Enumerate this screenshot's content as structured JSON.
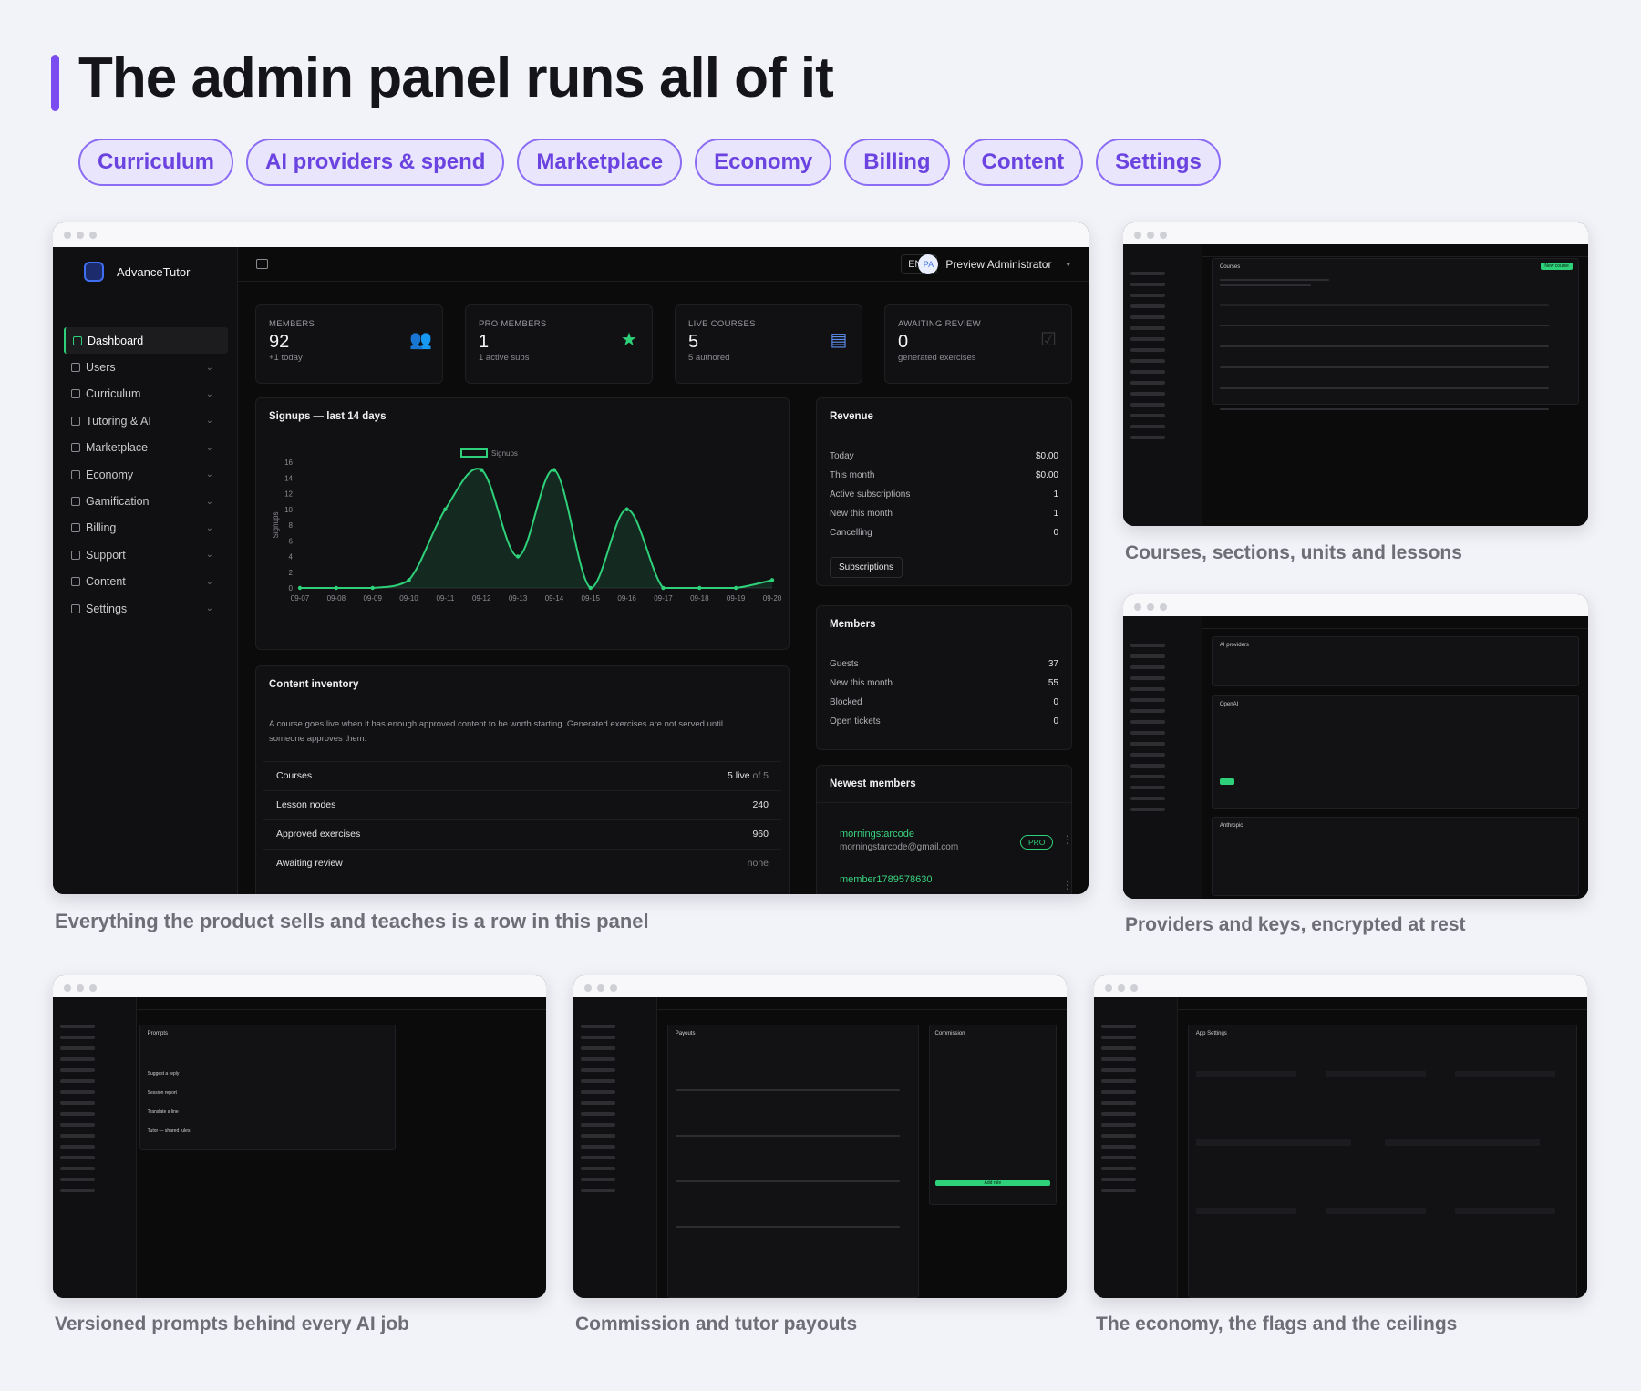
{
  "heading": "The admin panel runs all of it",
  "tags": [
    "Curriculum",
    "AI providers & spend",
    "Marketplace",
    "Economy",
    "Billing",
    "Content",
    "Settings"
  ],
  "captions": {
    "main": "Everything the product sells and teaches is a row in this panel",
    "courses": "Courses, sections, units and lessons",
    "providers": "Providers and keys, encrypted at rest",
    "prompts": "Versioned prompts behind every AI job",
    "payouts": "Commission and tutor payouts",
    "economy": "The economy, the flags and the ceilings"
  },
  "app": {
    "brand": "AdvanceTutor",
    "lang": "EN",
    "user_initials": "PA",
    "user_name": "Preview Administrator",
    "nav": [
      {
        "label": "Dashboard",
        "icon": "grid-icon",
        "active": true
      },
      {
        "label": "Users",
        "icon": "user-icon"
      },
      {
        "label": "Curriculum",
        "icon": "book-icon"
      },
      {
        "label": "Tutoring & AI",
        "icon": "robot-icon"
      },
      {
        "label": "Marketplace",
        "icon": "store-icon"
      },
      {
        "label": "Economy",
        "icon": "gem-icon"
      },
      {
        "label": "Gamification",
        "icon": "trophy-icon"
      },
      {
        "label": "Billing",
        "icon": "card-icon"
      },
      {
        "label": "Support",
        "icon": "chat-icon"
      },
      {
        "label": "Content",
        "icon": "file-icon"
      },
      {
        "label": "Settings",
        "icon": "gear-icon"
      }
    ],
    "stats": [
      {
        "label": "MEMBERS",
        "value": "92",
        "sub": "+1 today",
        "icon": "users-icon"
      },
      {
        "label": "PRO MEMBERS",
        "value": "1",
        "sub": "1 active subs",
        "icon": "star-icon"
      },
      {
        "label": "LIVE COURSES",
        "value": "5",
        "sub": "5 authored",
        "icon": "book-open-icon"
      },
      {
        "label": "AWAITING REVIEW",
        "value": "0",
        "sub": "generated exercises",
        "icon": "check-icon"
      }
    ],
    "signups": {
      "title": "Signups — last 14 days"
    },
    "revenue": {
      "title": "Revenue",
      "rows": [
        {
          "label": "Today",
          "value": "$0.00"
        },
        {
          "label": "This month",
          "value": "$0.00"
        },
        {
          "label": "Active subscriptions",
          "value": "1"
        },
        {
          "label": "New this month",
          "value": "1"
        },
        {
          "label": "Cancelling",
          "value": "0"
        }
      ],
      "button": "Subscriptions"
    },
    "members": {
      "title": "Members",
      "rows": [
        {
          "label": "Guests",
          "value": "37"
        },
        {
          "label": "New this month",
          "value": "55"
        },
        {
          "label": "Blocked",
          "value": "0"
        },
        {
          "label": "Open tickets",
          "value": "0"
        }
      ]
    },
    "newest": {
      "title": "Newest members",
      "items": [
        {
          "name": "morningstarcode",
          "email": "morningstarcode@gmail.com",
          "badge": "PRO"
        },
        {
          "name": "member1789578630",
          "email": ""
        }
      ]
    },
    "inventory": {
      "title": "Content inventory",
      "desc": "A course goes live when it has enough approved content to be worth starting. Generated exercises are not served until someone approves them.",
      "rows": [
        {
          "label": "Courses",
          "value": "5 live",
          "suffix": "of 5"
        },
        {
          "label": "Lesson nodes",
          "value": "240",
          "suffix": ""
        },
        {
          "label": "Approved exercises",
          "value": "960",
          "suffix": ""
        },
        {
          "label": "Awaiting review",
          "value": "none",
          "suffix": ""
        }
      ]
    }
  },
  "chart_data": {
    "type": "line",
    "title": "Signups — last 14 days",
    "ylabel": "Signups",
    "x": [
      "09-07",
      "09-08",
      "09-09",
      "09-10",
      "09-11",
      "09-12",
      "09-13",
      "09-14",
      "09-15",
      "09-16",
      "09-17",
      "09-18",
      "09-19",
      "09-20"
    ],
    "series": [
      {
        "name": "Signups",
        "values": [
          0,
          0,
          0,
          1,
          10,
          15,
          4,
          15,
          0,
          10,
          0,
          0,
          0,
          1
        ]
      }
    ],
    "ylim": [
      0,
      16
    ],
    "yticks": [
      0,
      2,
      4,
      6,
      8,
      10,
      12,
      14,
      16
    ],
    "legend": "top-center",
    "color": "#2fd07a"
  },
  "minis": {
    "courses_title": "Courses",
    "courses_button": "New course",
    "providers_title": "AI providers",
    "provider_names": [
      "OpenAI",
      "Anthropic"
    ],
    "prompts_title": "Prompts",
    "prompt_rows": [
      "Suggest a reply",
      "Session report",
      "Translate a line",
      "Tutor — shared rules"
    ],
    "payouts_title": "Payouts",
    "commission_title": "Commission",
    "commission_button": "Add rule",
    "settings_title": "App Settings"
  }
}
